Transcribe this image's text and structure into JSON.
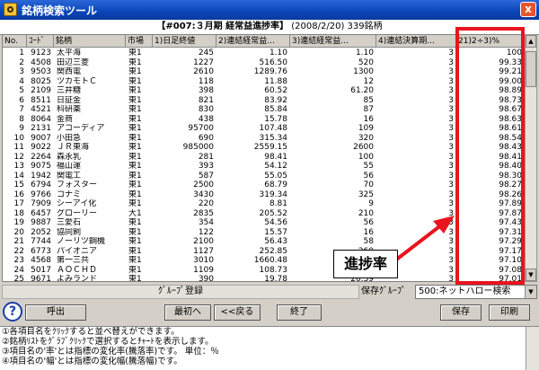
{
  "window": {
    "title": "銘柄検索ツール",
    "close_label": "x"
  },
  "header": {
    "name": "【#007:３月期 経常益進捗率】",
    "info": "(2008/2/20) 339銘柄"
  },
  "columns": [
    "No.",
    "ｺｰﾄﾞ",
    "銘柄",
    "市場",
    "1)日足終値",
    "2)連結経常益...",
    "3)連結経常益...",
    "4)連結決算期...",
    "21)2÷3)%"
  ],
  "rows": [
    [
      "1",
      "9123",
      "太平海",
      "東1",
      "245",
      "1.10",
      "1.10",
      "3",
      "100"
    ],
    [
      "2",
      "4508",
      "田辺三菱",
      "東1",
      "1227",
      "516.50",
      "520",
      "3",
      "99.33"
    ],
    [
      "3",
      "9503",
      "関西電",
      "東1",
      "2610",
      "1289.76",
      "1300",
      "3",
      "99.21"
    ],
    [
      "4",
      "8025",
      "ツカモトＣ",
      "東1",
      "118",
      "11.88",
      "12",
      "3",
      "99.00"
    ],
    [
      "5",
      "2109",
      "三井糖",
      "東1",
      "398",
      "60.52",
      "61.20",
      "3",
      "98.89"
    ],
    [
      "6",
      "8511",
      "日証金",
      "東1",
      "821",
      "83.92",
      "85",
      "3",
      "98.73"
    ],
    [
      "7",
      "4521",
      "科研薬",
      "東1",
      "830",
      "85.84",
      "87",
      "3",
      "98.67"
    ],
    [
      "8",
      "8064",
      "金商",
      "東1",
      "438",
      "15.78",
      "16",
      "3",
      "98.63"
    ],
    [
      "9",
      "2131",
      "アコーディア",
      "東1",
      "95700",
      "107.48",
      "109",
      "3",
      "98.61"
    ],
    [
      "10",
      "9007",
      "小田急",
      "東1",
      "690",
      "315.34",
      "320",
      "3",
      "98.54"
    ],
    [
      "11",
      "9022",
      "ＪＲ東海",
      "東1",
      "985000",
      "2559.15",
      "2600",
      "3",
      "98.43"
    ],
    [
      "12",
      "2264",
      "森永乳",
      "東1",
      "281",
      "98.41",
      "100",
      "3",
      "98.41"
    ],
    [
      "13",
      "9075",
      "福山運",
      "東1",
      "393",
      "54.12",
      "55",
      "3",
      "98.40"
    ],
    [
      "14",
      "1942",
      "関電工",
      "東1",
      "587",
      "55.05",
      "56",
      "3",
      "98.30"
    ],
    [
      "15",
      "6794",
      "フォスター",
      "東1",
      "2500",
      "68.79",
      "70",
      "3",
      "98.27"
    ],
    [
      "16",
      "9766",
      "コナミ",
      "東1",
      "3430",
      "319.34",
      "325",
      "3",
      "98.26"
    ],
    [
      "17",
      "7909",
      "シーアイ化",
      "東1",
      "220",
      "8.81",
      "9",
      "3",
      "97.89"
    ],
    [
      "18",
      "6457",
      "グローリー",
      "大1",
      "2835",
      "205.52",
      "210",
      "3",
      "97.87"
    ],
    [
      "19",
      "9887",
      "三愛石",
      "東1",
      "354",
      "54.56",
      "56",
      "3",
      "97.43"
    ],
    [
      "20",
      "2052",
      "協同飼",
      "東1",
      "122",
      "15.57",
      "16",
      "3",
      "97.31"
    ],
    [
      "21",
      "7744",
      "ノーリツ鋼機",
      "東1",
      "2100",
      "56.43",
      "58",
      "3",
      "97.29"
    ],
    [
      "22",
      "6773",
      "パイオニア",
      "東1",
      "1127",
      "252.85",
      "260",
      "3",
      "97.17"
    ],
    [
      "23",
      "4568",
      "第一三共",
      "東1",
      "3010",
      "1660.48",
      "1710",
      "3",
      "97.10"
    ],
    [
      "24",
      "5017",
      "ＡＯＣＨＤ",
      "東1",
      "1109",
      "108.73",
      "112",
      "3",
      "97.08"
    ],
    [
      "25",
      "9671",
      "よみランド",
      "東1",
      "390",
      "19.78",
      "20.39",
      "3",
      "97.01"
    ]
  ],
  "group": {
    "label": "ｸﾞﾙｰﾌﾟ登録",
    "save_group_label": "保存ｸﾞﾙｰﾌﾟ",
    "selected": "500:ネットハロー検索"
  },
  "buttons": {
    "help": "?",
    "call": "呼出",
    "first": "最初へ",
    "back": "<<戻る",
    "end": "終了",
    "save": "保存",
    "print": "印刷"
  },
  "callout": {
    "text": "進捗率"
  },
  "help_lines": [
    "①各項目名をｸﾘｯｸすると並べ替えができます。",
    "②銘柄ﾘｽﾄをｸﾞﾗﾌﾞｸﾘｯｸで選択するとﾁｬｰﾄを表示します。",
    "③項目名の'率'とは指標の変化率(騰落率)です。 単位：％",
    "④項目名の'幅'とは指標の変化幅(騰落幅)です。"
  ],
  "colors": {
    "title_bar": "#0b45b8",
    "highlight": "#e8141e"
  }
}
